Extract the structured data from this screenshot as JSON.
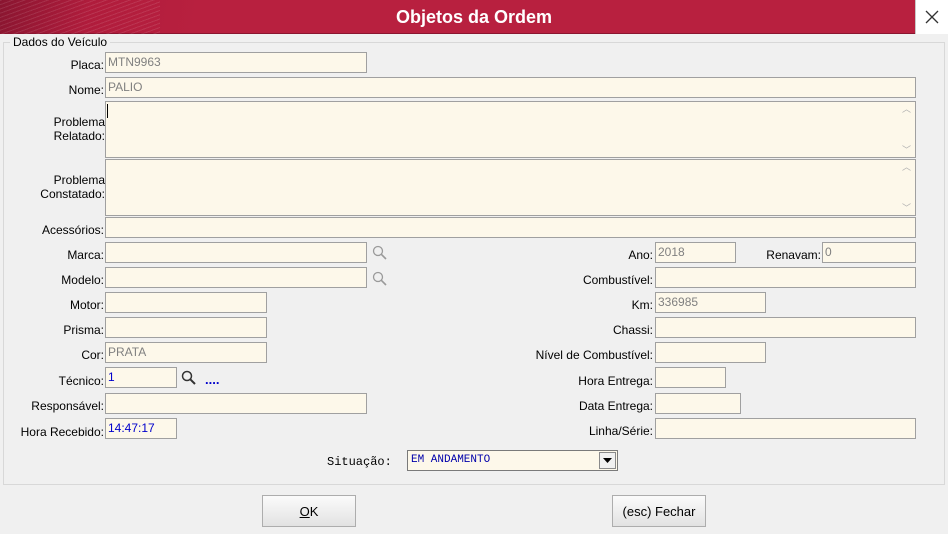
{
  "window": {
    "title": "Objetos da Ordem"
  },
  "group": {
    "legend": "Dados do Veículo"
  },
  "labels": {
    "placa": "Placa:",
    "nome": "Nome:",
    "problema_relatado": "Problema Relatado:",
    "problema_constatado": "Problema Constatado:",
    "acessorios": "Acessórios:",
    "marca": "Marca:",
    "modelo": "Modelo:",
    "motor": "Motor:",
    "prisma": "Prisma:",
    "cor": "Cor:",
    "tecnico": "Técnico:",
    "responsavel": "Responsável:",
    "hora_recebido": "Hora Recebido:",
    "ano": "Ano:",
    "renavam": "Renavam:",
    "combustivel": "Combustível:",
    "km": "Km:",
    "chassi": "Chassi:",
    "nivel_combustivel": "Nível de Combustível:",
    "hora_entrega": "Hora Entrega:",
    "data_entrega": "Data Entrega:",
    "linha_serie": "Linha/Série:",
    "situacao": "Situação:"
  },
  "values": {
    "placa": "MTN9963",
    "nome": "PALIO",
    "problema_relatado": "",
    "problema_constatado": "",
    "acessorios": "",
    "marca": "",
    "modelo": "",
    "motor": "",
    "prisma": "",
    "cor": "PRATA",
    "tecnico": "1",
    "tecnico_more": "....",
    "responsavel": "",
    "hora_recebido": "14:47:17",
    "ano": "2018",
    "renavam": "0",
    "combustivel": "",
    "km": "336985",
    "chassi": "",
    "nivel_combustivel": "",
    "hora_entrega": "",
    "data_entrega": "",
    "linha_serie": "",
    "situacao": "EM ANDAMENTO"
  },
  "buttons": {
    "ok_underlined": "O",
    "ok_rest": "K",
    "fechar": "(esc) Fechar"
  },
  "colors": {
    "titlebar": "#b8203f",
    "field_bg": "#fdf8ea",
    "accent_blue": "#0000cc"
  }
}
